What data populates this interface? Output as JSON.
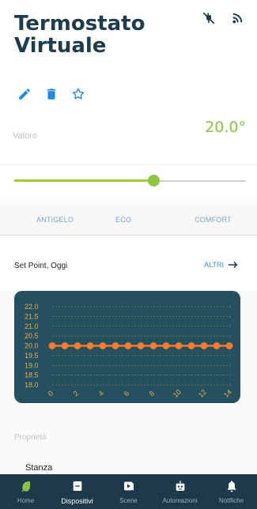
{
  "header": {
    "title": "Termostato Virtuale",
    "icons": [
      "plug-off-icon",
      "signal-icon"
    ],
    "actions": [
      "edit-icon",
      "delete-icon",
      "star-icon"
    ]
  },
  "value": {
    "label": "Valore",
    "number": "20.0°"
  },
  "slider": {
    "level": 0.6
  },
  "modes": [
    "ANTIGELO",
    "ECO",
    "COMFORT"
  ],
  "setpoint": {
    "label": "Set Point, Oggi",
    "more": "ALTRI"
  },
  "chart_data": {
    "type": "line",
    "x": [
      0,
      1,
      2,
      3,
      4,
      5,
      6,
      7,
      8,
      9,
      10,
      11,
      12,
      13,
      14
    ],
    "x_ticks": [
      0,
      2,
      4,
      6,
      8,
      10,
      12,
      14
    ],
    "y_ticks": [
      "22.0",
      "21.5",
      "21.0",
      "20.5",
      "20.0",
      "19.5",
      "19.0",
      "18.5",
      "18.0"
    ],
    "ylim": [
      18.0,
      22.0
    ],
    "series": [
      {
        "values": [
          20,
          20,
          20,
          20,
          20,
          20,
          20,
          20,
          20,
          20,
          20,
          20,
          20,
          20,
          20
        ]
      }
    ],
    "colors": {
      "line": "#ff7a2f",
      "background": "#25505f",
      "grid": "#e8b04a",
      "tick": "#e8b04a"
    }
  },
  "properties": {
    "label": "Proprietà",
    "room": "Stanza"
  },
  "nav": [
    {
      "label": "Home",
      "icon": "leaf-icon"
    },
    {
      "label": "Dispositivi",
      "icon": "device-icon",
      "active": true
    },
    {
      "label": "Scene",
      "icon": "scene-icon"
    },
    {
      "label": "Automazioni",
      "icon": "robot-icon"
    },
    {
      "label": "Notifiche",
      "icon": "bell-icon"
    }
  ],
  "colors": {
    "brand": "#1d3a4a",
    "accent_green": "#8bc34a",
    "link_blue": "#3f8fd8"
  }
}
